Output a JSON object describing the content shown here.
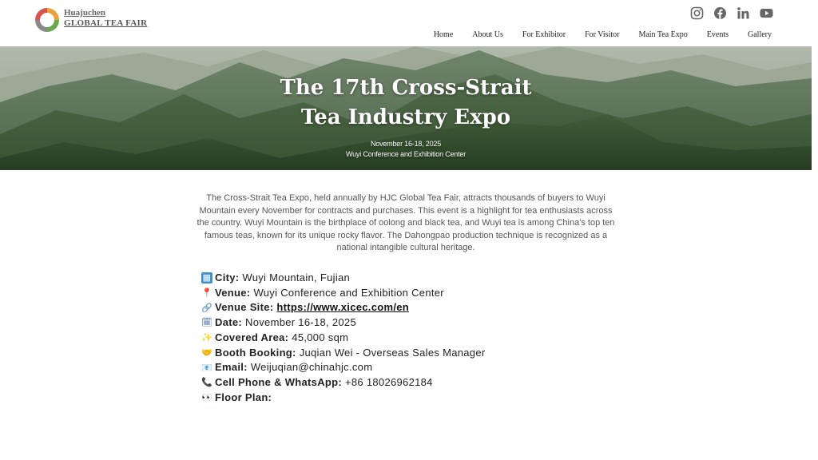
{
  "header": {
    "logo_line1": "Huajuchen",
    "logo_line2": "GLOBAL TEA FAIR",
    "social_icons": [
      "instagram-icon",
      "facebook-icon",
      "linkedin-icon",
      "youtube-icon"
    ],
    "nav": [
      "Home",
      "About Us",
      "For Exhibitor",
      "For Visitor",
      "Main Tea Expo",
      "Events",
      "Gallery"
    ]
  },
  "hero": {
    "title_line1": "The 17th Cross-Strait",
    "title_line2": "Tea Industry Expo",
    "date": "November 16-18, 2025",
    "venue": "Wuyi Conference and Exhibition Center"
  },
  "intro": "The Cross-Strait Tea Expo, held annually by HJC Global Tea Fair, attracts thousands of buyers to Wuyi Mountain every November for contracts and purchases. This event is a highlight for tea enthusiasts across the country. Wuyi Mountain is the birthplace of oolong and black tea, and Wuyi tea is among China's top ten famous teas, known for its unique rocky flavor. The Dahongpao production technique is recognized as a national intangible cultural heritage.",
  "details": {
    "city_label": "City:",
    "city_value": "Wuyi Mountain, Fujian",
    "venue_label": "Venue:",
    "venue_value": "Wuyi Conference and Exhibition Center",
    "site_label": "Venue Site:",
    "site_value": "https://www.xicec.com/en",
    "date_label": "Date:",
    "date_value": "November 16-18, 2025",
    "area_label": "Covered Area:",
    "area_value": "45,000 sqm",
    "booking_label": "Booth Booking:",
    "booking_value": "Juqian Wei  - Overseas Sales Manager",
    "email_label": "Email:",
    "email_value": "Weijuqian@chinahjc.com",
    "phone_label": "Cell Phone & WhatsApp:",
    "phone_value": "+86 18026962184",
    "floor_label": "Floor Plan:"
  },
  "colors": {
    "accent_red": "#d9534f",
    "accent_green": "#6aa84f",
    "accent_orange": "#f0a030",
    "hero_green": "#5f7f58"
  }
}
